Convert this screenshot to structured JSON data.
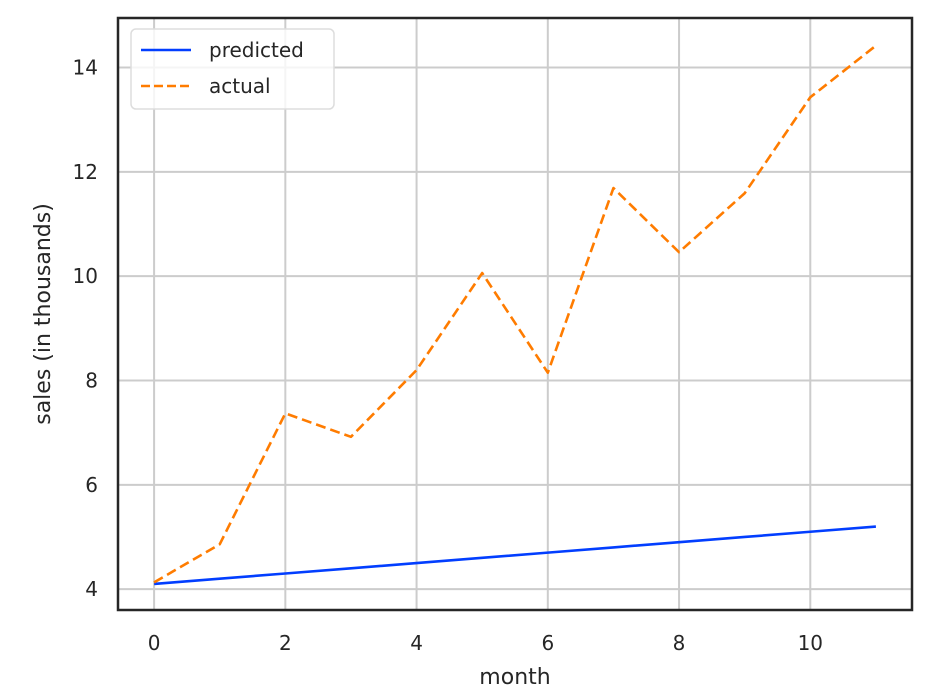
{
  "chart_data": {
    "type": "line",
    "title": "",
    "xlabel": "month",
    "ylabel": "sales (in thousands)",
    "xlim": [
      -0.55,
      11.55
    ],
    "ylim": [
      3.6,
      14.95
    ],
    "x_ticks": [
      0,
      2,
      4,
      6,
      8,
      10
    ],
    "y_ticks": [
      4,
      6,
      8,
      10,
      12,
      14
    ],
    "grid": true,
    "legend_position": "top-left",
    "x": [
      0,
      1,
      2,
      3,
      4,
      5,
      6,
      7,
      8,
      9,
      10,
      11
    ],
    "series": [
      {
        "name": "predicted",
        "style": "solid",
        "color": "#023eff",
        "values": [
          4.1,
          4.2,
          4.3,
          4.4,
          4.5,
          4.6,
          4.7,
          4.8,
          4.9,
          5.0,
          5.1,
          5.2
        ]
      },
      {
        "name": "actual",
        "style": "dashed",
        "color": "#ff7c00",
        "values": [
          4.13,
          4.86,
          7.37,
          6.92,
          8.2,
          10.06,
          8.15,
          11.69,
          10.46,
          11.59,
          13.43,
          14.42
        ]
      }
    ]
  }
}
